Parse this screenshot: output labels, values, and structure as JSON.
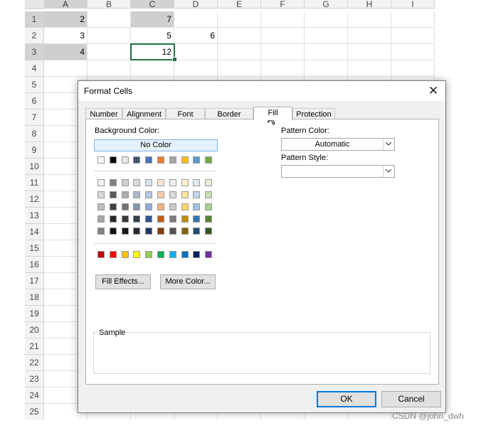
{
  "sheet": {
    "columns": [
      "A",
      "B",
      "C",
      "D",
      "E",
      "F",
      "G",
      "H",
      "I"
    ],
    "rows": [
      "1",
      "2",
      "3",
      "4",
      "5",
      "6",
      "7",
      "8",
      "9",
      "10",
      "11",
      "12",
      "13",
      "14",
      "15",
      "16",
      "17",
      "18",
      "19",
      "20",
      "21",
      "22",
      "23",
      "24",
      "25"
    ],
    "cells": {
      "A1": "2",
      "C1": "7",
      "A2": "3",
      "C2": "5",
      "D2": "6",
      "A3": "4",
      "C3": "12"
    }
  },
  "dialog": {
    "title": "Format Cells",
    "close_label": "✕",
    "tabs": [
      "Number",
      "Alignment",
      "Font",
      "Border",
      "Fill",
      "Protection"
    ],
    "active_tab": "Fill",
    "background_color_label": "Background Color:",
    "no_color_label": "No Color",
    "theme_colors_top": [
      "#ffffff",
      "#000000",
      "#e7e6e6",
      "#44546a",
      "#4472c4",
      "#ed7d31",
      "#a5a5a5",
      "#ffc000",
      "#5b9bd5",
      "#70ad47"
    ],
    "theme_shades": [
      [
        "#f2f2f2",
        "#808080",
        "#d0cece",
        "#d6dce4",
        "#d9e2f3",
        "#fbe5d5",
        "#ededed",
        "#fff2cc",
        "#deebf6",
        "#e2efd9"
      ],
      [
        "#d8d8d8",
        "#595959",
        "#aeabab",
        "#adb9ca",
        "#b4c6e7",
        "#f7cbac",
        "#dbdbdb",
        "#fee599",
        "#bdd7ee",
        "#c5e0b3"
      ],
      [
        "#bfbfbf",
        "#3f3f3f",
        "#757070",
        "#8496b0",
        "#8eaadb",
        "#f4b183",
        "#c9c9c9",
        "#ffd965",
        "#9cc3e5",
        "#a8d08d"
      ],
      [
        "#a5a5a5",
        "#262626",
        "#3a3838",
        "#323f4f",
        "#2f5496",
        "#c55a11",
        "#7b7b7b",
        "#bf9000",
        "#2e75b5",
        "#538135"
      ],
      [
        "#7f7f7f",
        "#0c0c0c",
        "#171616",
        "#222a35",
        "#1f3864",
        "#833c0b",
        "#525252",
        "#7f6000",
        "#1e4e79",
        "#375623"
      ]
    ],
    "standard_colors": [
      "#c00000",
      "#ff0000",
      "#ffc000",
      "#ffff00",
      "#92d050",
      "#00b050",
      "#00b0f0",
      "#0070c0",
      "#002060",
      "#7030a0"
    ],
    "fill_effects_label": "Fill Effects...",
    "more_colors_label": "More Color...",
    "pattern_color_label": "Pattern Color:",
    "pattern_color_value": "Automatic",
    "pattern_style_label": "Pattern Style:",
    "pattern_style_value": "",
    "sample_label": "Sample",
    "ok_label": "OK",
    "cancel_label": "Cancel"
  },
  "watermark": "CSDN @john_dwh"
}
